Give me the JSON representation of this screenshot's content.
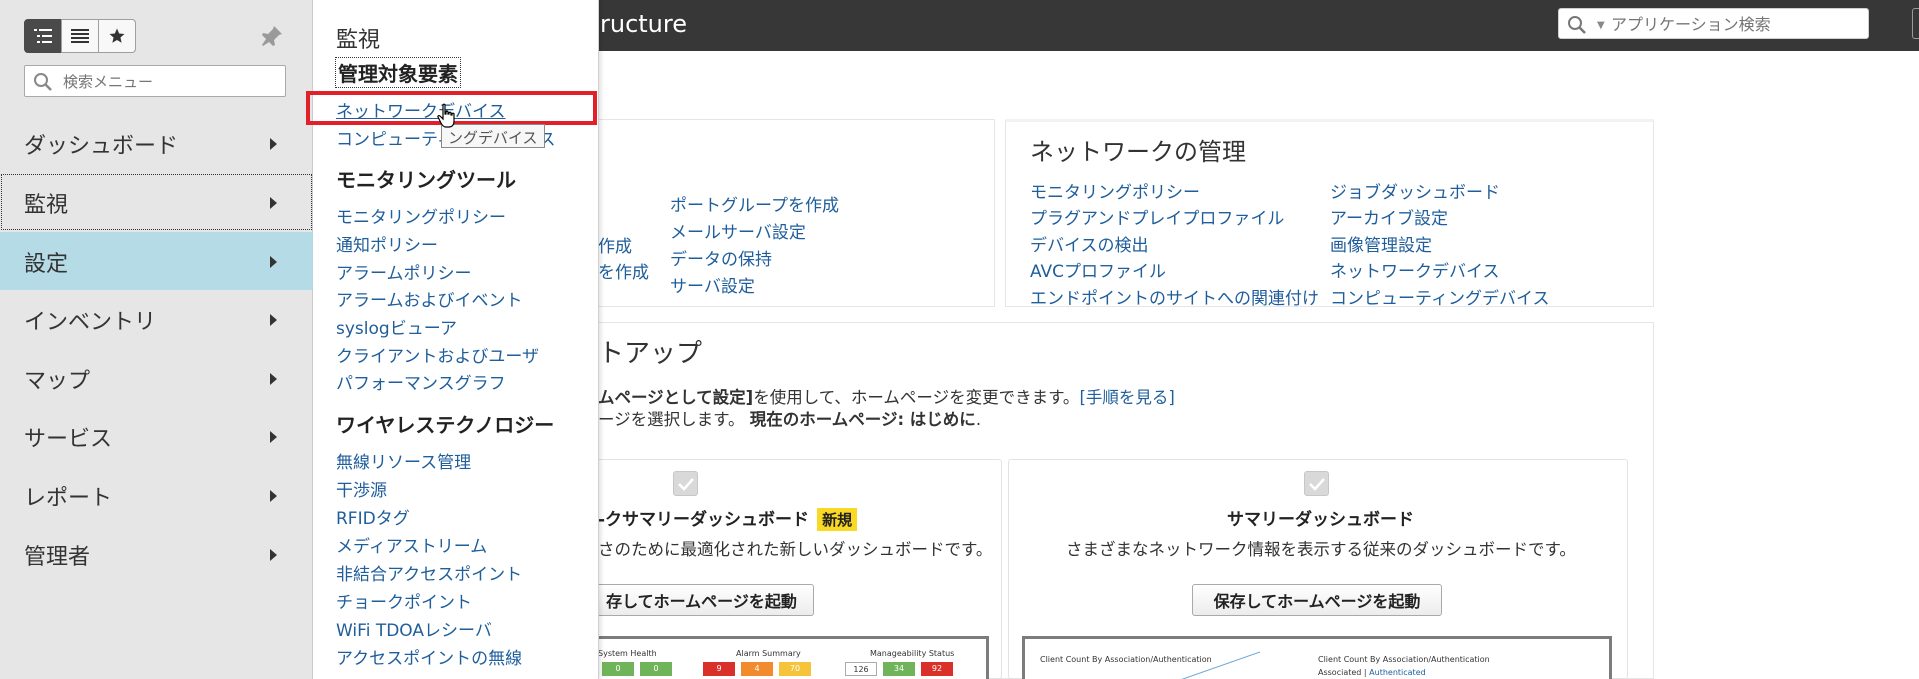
{
  "header": {
    "title": "ructure",
    "search_placeholder": "アプリケーション検索"
  },
  "sidebar": {
    "search_placeholder": "検索メニュー",
    "items": [
      {
        "label": "ダッシュボード"
      },
      {
        "label": "監視"
      },
      {
        "label": "設定"
      },
      {
        "label": "インベントリ"
      },
      {
        "label": "マップ"
      },
      {
        "label": "サービス"
      },
      {
        "label": "レポート"
      },
      {
        "label": "管理者"
      }
    ]
  },
  "flyout": {
    "heading": "監視",
    "managed_title": "管理対象要素",
    "managed_links": [
      "ネットワークデバイス",
      "コンピューティングデバイス"
    ],
    "tooltip": "ングデバイス",
    "tools_title": "モニタリングツール",
    "tools_links": [
      "モニタリングポリシー",
      "通知ポリシー",
      "アラームポリシー",
      "アラームおよびイベント",
      "syslogビューア",
      "クライアントおよびユーザ",
      "パフォーマンスグラフ"
    ],
    "wireless_title": "ワイヤレステクノロジー",
    "wireless_links": [
      "無線リソース管理",
      "干渉源",
      "RFIDタグ",
      "メディアストリーム",
      "非結合アクセスポイント",
      "チョークポイント",
      "WiFi TDOAレシーバ",
      "アクセスポイントの無線"
    ]
  },
  "left_card": {
    "partial_links": [
      "作成",
      "を作成"
    ],
    "links": [
      "ポートグループを作成",
      "メールサーバ設定",
      "データの保持",
      "サーバ設定"
    ]
  },
  "network_card": {
    "title": "ネットワークの管理",
    "col1": [
      "モニタリングポリシー",
      "プラグアンドプレイプロファイル",
      "デバイスの検出",
      "AVCプロファイル",
      "エンドポイントのサイトへの関連付け"
    ],
    "col2": [
      "ジョブダッシュボード",
      "アーカイブ設定",
      "画像管理設定",
      "ネットワークデバイス",
      "コンピューティングデバイス"
    ]
  },
  "setup": {
    "title": "トアップ",
    "line1_bold": "ムページとして設定]",
    "line1_text": "を使用して、ホームページを変更できます。",
    "line1_link": "[手順を見る]",
    "line2_text": "ージを選択します。",
    "line2_bold": "現在のホームページ: はじめに",
    "line2_end": "."
  },
  "options": [
    {
      "title": "-クサマリーダッシュボード",
      "badge": "新規",
      "desc": "さのために最適化された新しいダッシュボードです。",
      "button": "存してホームページを起動"
    },
    {
      "title": "サマリーダッシュボード",
      "desc": "さまざまなネットワーク情報を表示する従来のダッシュボードです。",
      "button": "保存してホームページを起動"
    }
  ],
  "preview1": {
    "labels": [
      "System Health",
      "Alarm Summary",
      "Manageability Status"
    ],
    "values": [
      "0",
      "0",
      "9",
      "4",
      "70",
      "126",
      "34",
      "92"
    ]
  },
  "preview2": {
    "labels": [
      "Client Count By Association/Authentication",
      "Client Count By Association/Authentication"
    ],
    "sub_labels": [
      "Associated",
      "Authenticated"
    ]
  },
  "colors": {
    "accent_blue": "#1f5e9b",
    "active_nav": "#b5dbe7",
    "highlight_red": "#e0212a",
    "badge_yellow": "#f9d923",
    "header_bg": "#373737"
  }
}
